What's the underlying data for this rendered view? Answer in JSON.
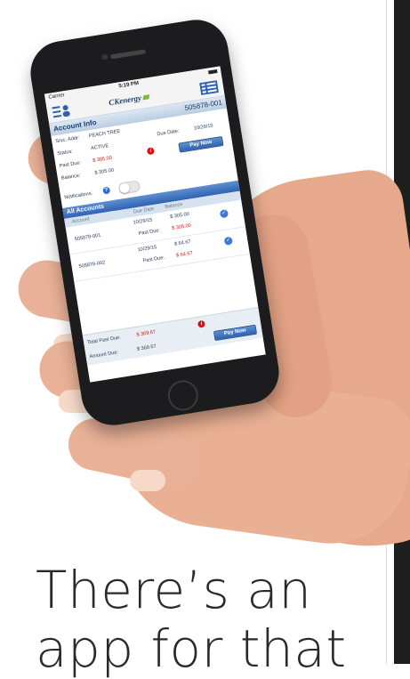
{
  "status_bar": {
    "carrier": "Carrier",
    "time": "5:19 PM"
  },
  "nav": {
    "logo": "CKenergy",
    "left_icon": "account-menu-icon",
    "right_icon": "list-icon"
  },
  "account_info": {
    "title": "Account Info",
    "account_number": "505878-001",
    "service_address_label": "Srvc. Addr:",
    "service_address": "PEACH TREE",
    "status_label": "Status:",
    "status": "ACTIVE",
    "due_date_label": "Due Date:",
    "due_date": "10/29/15",
    "past_due_label": "Past Due:",
    "past_due": "$ 305.00",
    "balance_label": "Balance:",
    "balance": "$ 305.00",
    "pay_now": "Pay Now",
    "notifications_label": "Notifications:",
    "notifications_on": false
  },
  "all_accounts": {
    "title": "All Accounts",
    "columns": [
      "Account",
      "Due Date",
      "Balance"
    ],
    "rows": [
      {
        "account": "505878-001",
        "due_date": "10/29/15",
        "balance": "$ 305.00",
        "past_due_label": "Past Due:",
        "past_due": "$ 305.00"
      },
      {
        "account": "505878-002",
        "due_date": "10/29/15",
        "balance": "$ 64.67",
        "past_due_label": "Past Due:",
        "past_due": "$ 64.67"
      }
    ]
  },
  "totals": {
    "total_past_due_label": "Total Past Due:",
    "total_past_due": "$ 369.67",
    "amount_due_label": "Amount Due:",
    "amount_due": "$ 369.67",
    "pay_now": "Pay Now"
  },
  "headline": {
    "line1": "There’s an",
    "line2": "app for that"
  },
  "colors": {
    "accent": "#2e62b1",
    "alert": "#dd1111",
    "brand_green": "#7dbb3c"
  }
}
